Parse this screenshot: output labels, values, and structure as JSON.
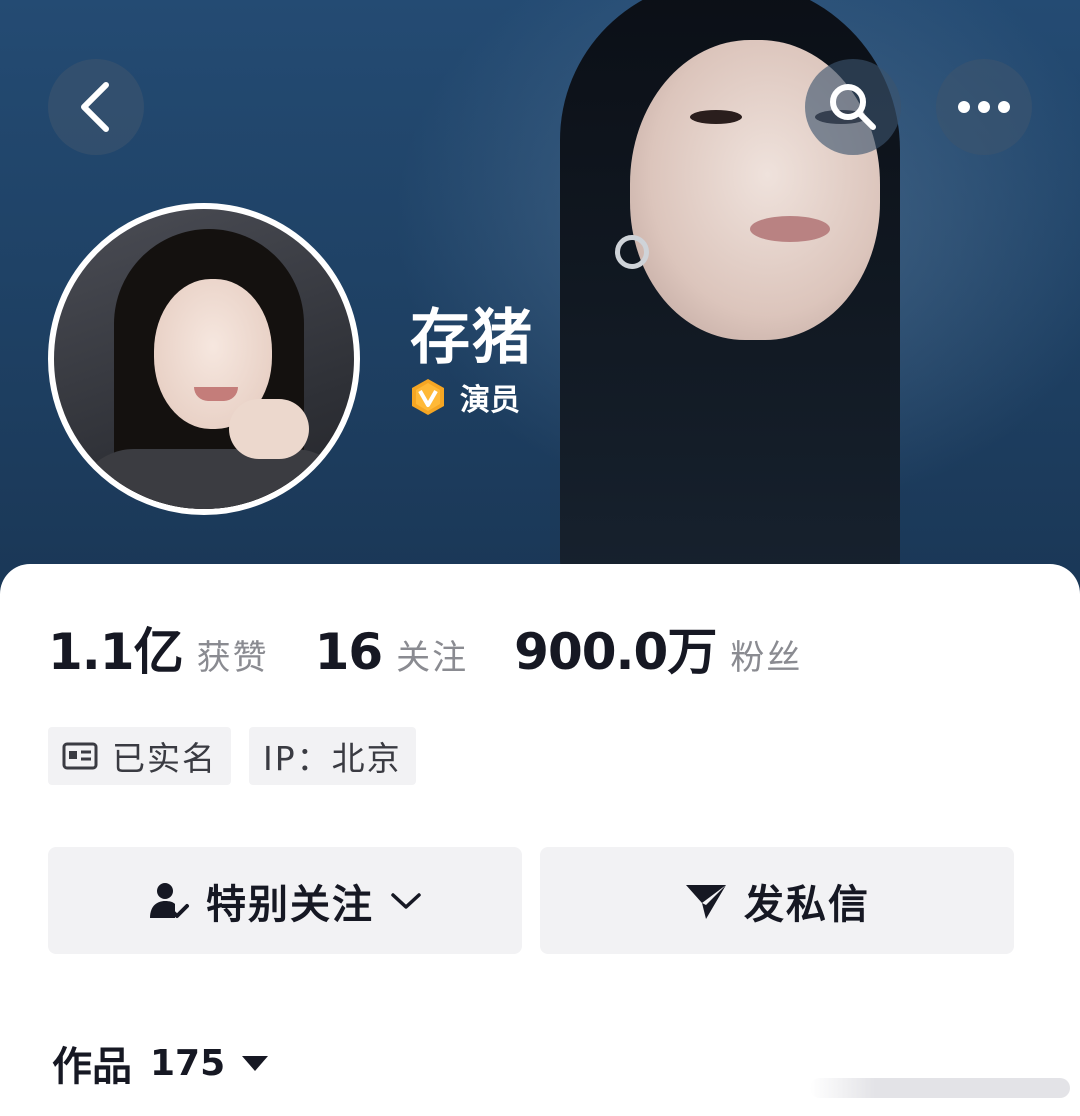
{
  "profile": {
    "nickname": "存猪",
    "verify_label": "演员",
    "verify_icon": "v-verified-badge-icon"
  },
  "nav": {
    "back_icon": "chevron-left-icon",
    "search_icon": "search-icon",
    "more_icon": "more-dots-icon"
  },
  "stats": [
    {
      "value": "1.1亿",
      "label": "获赞"
    },
    {
      "value": "16",
      "label": "关注"
    },
    {
      "value": "900.0万",
      "label": "粉丝"
    }
  ],
  "tags": [
    {
      "icon": "id-card-icon",
      "label": "已实名"
    },
    {
      "label": "IP：北京"
    }
  ],
  "actions": {
    "follow_label": "特别关注",
    "message_label": "发私信"
  },
  "works": {
    "label": "作品",
    "count": "175"
  },
  "colors": {
    "header_blue": "#1f4266",
    "verify_gold": "#f5a623",
    "button_bg": "#f2f2f4",
    "text_primary": "#161823",
    "text_secondary": "#8a8b91"
  }
}
